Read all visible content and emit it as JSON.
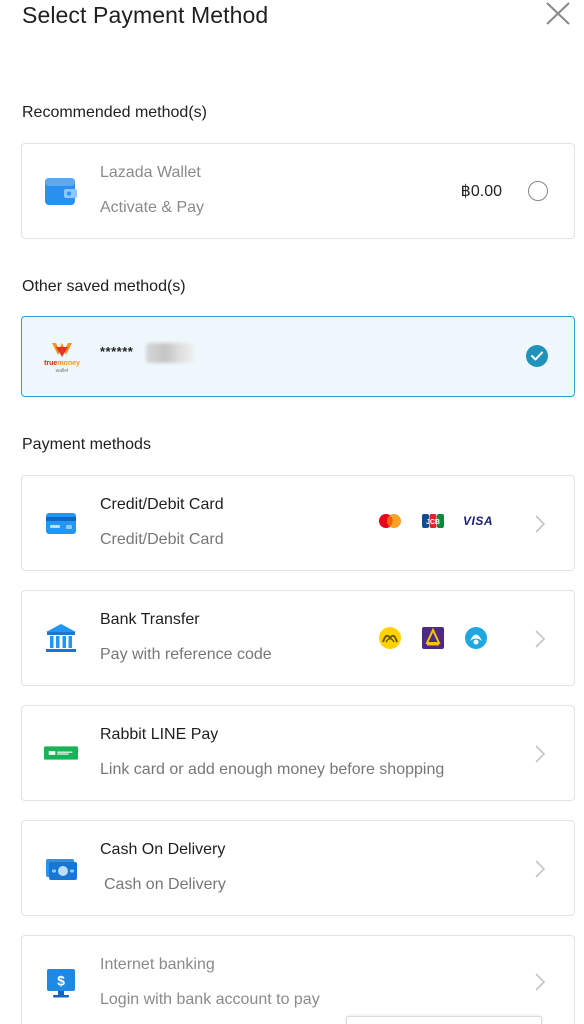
{
  "header": {
    "title": "Select Payment Method",
    "close_icon": "close-icon"
  },
  "sections": {
    "recommended": "Recommended method(s)",
    "other_saved": "Other saved method(s)",
    "payment_methods": "Payment methods"
  },
  "lazada_wallet": {
    "name": "Lazada Wallet",
    "subtitle": "Activate & Pay",
    "balance": "฿0.00",
    "icon": "wallet-icon",
    "selected": false
  },
  "saved_method": {
    "brand": "truemoney wallet",
    "masked_number": "******",
    "icon": "truemoney-wallet-logo",
    "selected": true
  },
  "methods": [
    {
      "name": "Credit/Debit Card",
      "subtitle": "Credit/Debit Card",
      "icon": "credit-card-icon",
      "logos": [
        "mastercard-logo",
        "jcb-logo",
        "visa-logo"
      ],
      "visa_text": "VISA"
    },
    {
      "name": "Bank Transfer",
      "subtitle": "Pay with reference code",
      "icon": "bank-icon",
      "logos": [
        "krungsri-logo",
        "scb-logo",
        "kasikorn-logo"
      ]
    },
    {
      "name": "Rabbit LINE Pay",
      "subtitle": "Link card or add enough money before shopping",
      "icon": "rabbit-line-pay-icon"
    },
    {
      "name": "Cash On Delivery",
      "subtitle": "Cash on Delivery",
      "icon": "cash-icon"
    },
    {
      "name": "Internet banking",
      "subtitle": "Login with bank account to pay",
      "icon": "internet-banking-icon",
      "disabled": true
    }
  ],
  "colors": {
    "accent": "#1f93b9",
    "card_icon_blue": "#2196f3",
    "line_green": "#19b257",
    "selected_bg": "#eef8fc"
  }
}
